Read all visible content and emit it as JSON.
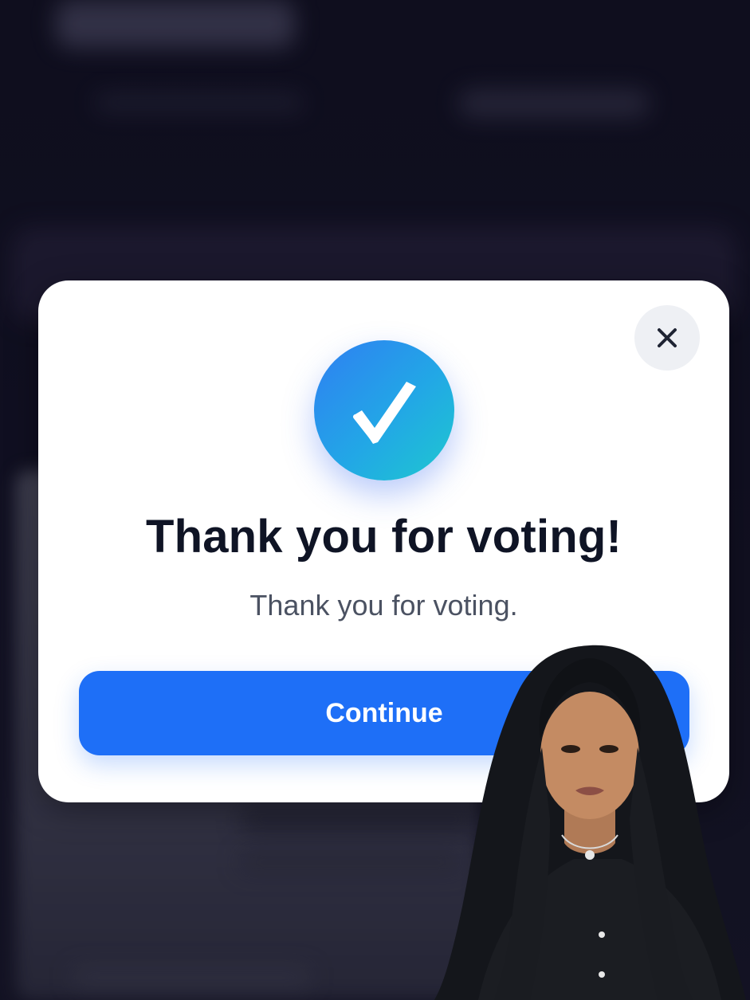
{
  "dialog": {
    "title": "Thank you for voting!",
    "message": "Thank you for voting.",
    "continue_label": "Continue",
    "close_icon": "close-icon",
    "status_icon": "checkmark-icon"
  },
  "colors": {
    "primary_button": "#1e6ff7",
    "badge_gradient_start": "#2f7ff2",
    "badge_gradient_end": "#1ec8cf",
    "title_text": "#0f1425",
    "subtitle_text": "#4b5262",
    "background": "#0f0e1d"
  }
}
